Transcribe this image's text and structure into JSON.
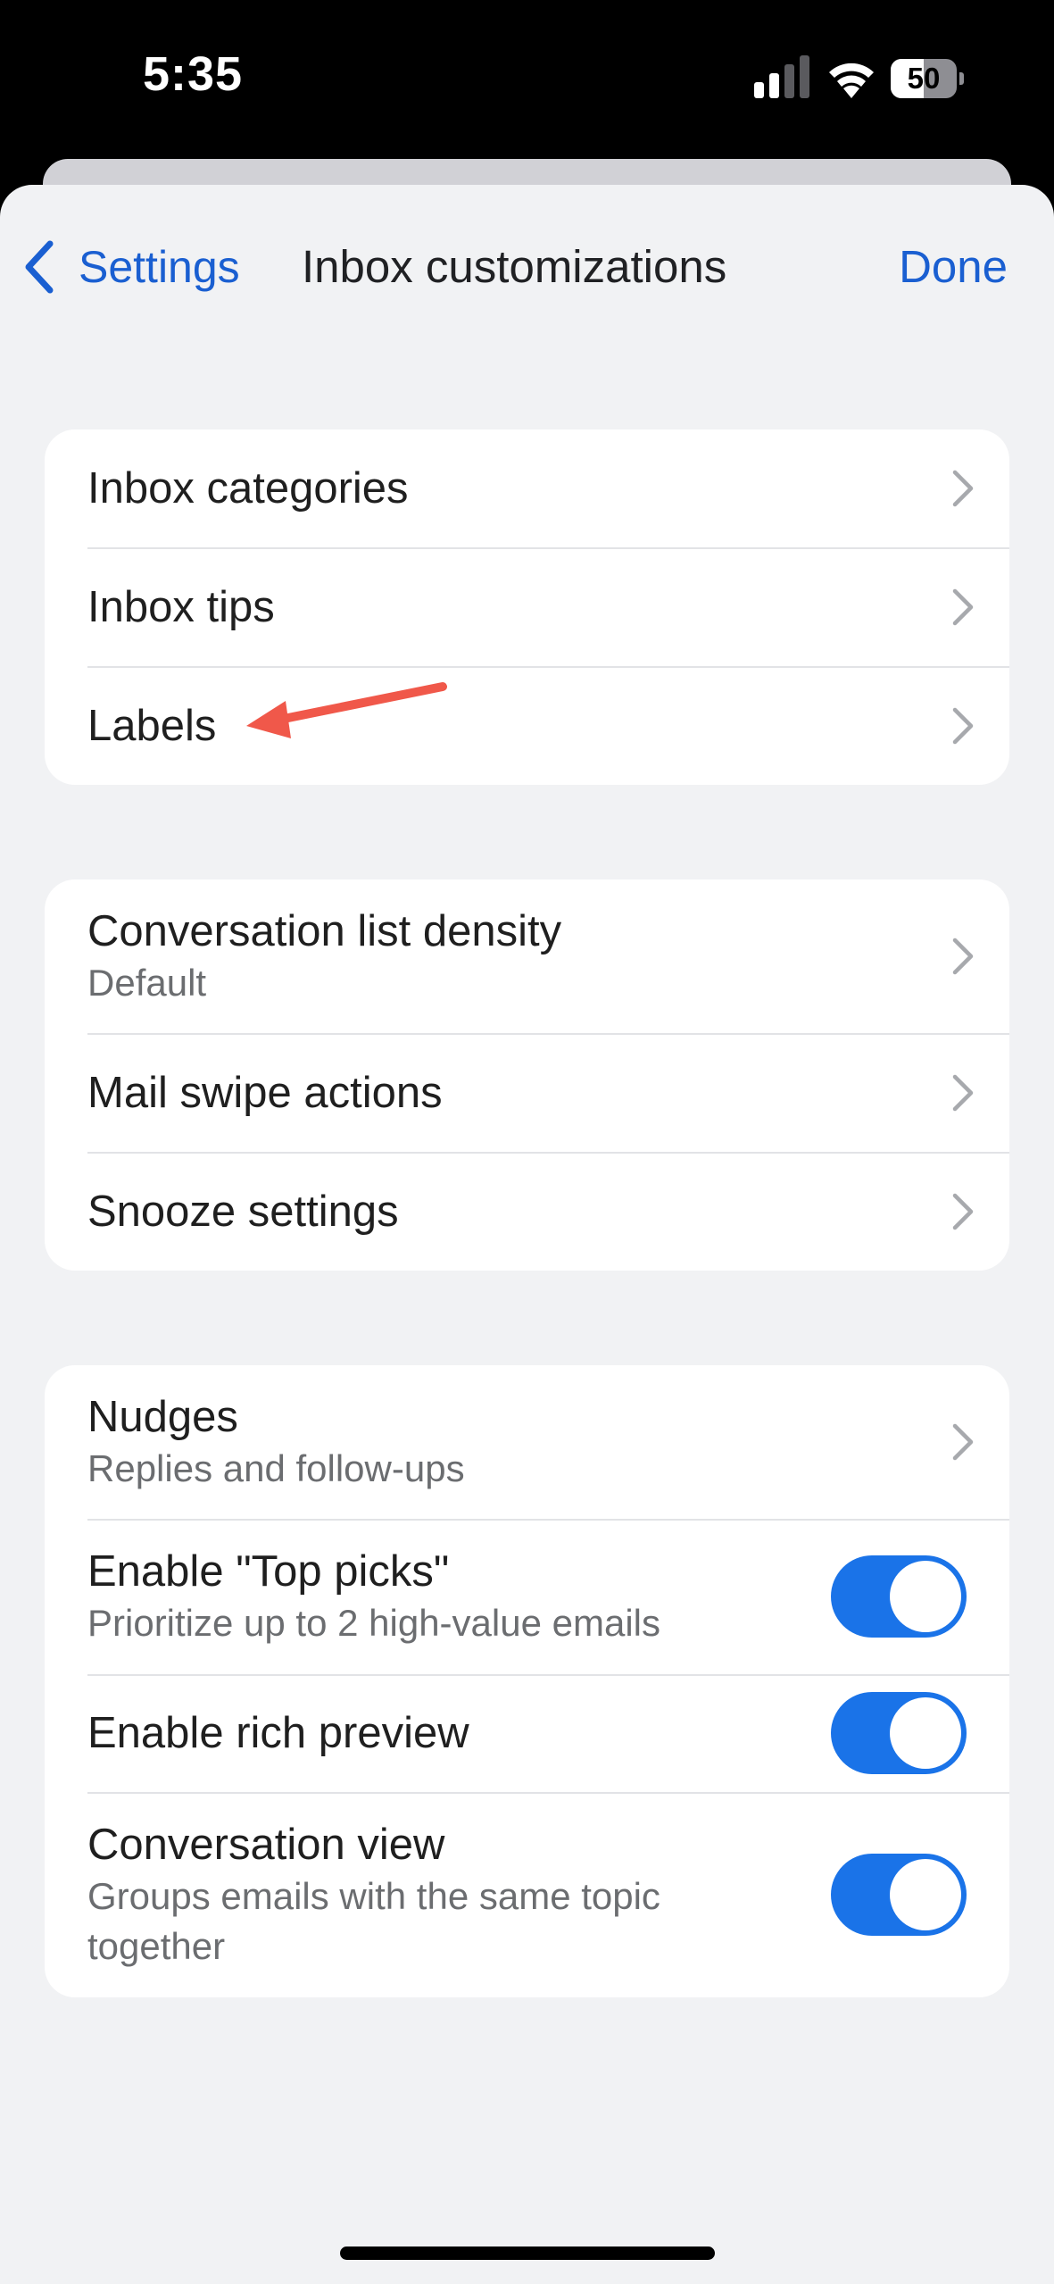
{
  "status_bar": {
    "time": "5:35",
    "battery": "50"
  },
  "nav": {
    "back_label": "Settings",
    "title": "Inbox customizations",
    "done_label": "Done"
  },
  "group1": [
    {
      "title": "Inbox categories"
    },
    {
      "title": "Inbox tips"
    },
    {
      "title": "Labels"
    }
  ],
  "group2": [
    {
      "title": "Conversation list density",
      "subtitle": "Default"
    },
    {
      "title": "Mail swipe actions"
    },
    {
      "title": "Snooze settings"
    }
  ],
  "group3": [
    {
      "title": "Nudges",
      "subtitle": "Replies and follow-ups"
    },
    {
      "title": "Enable \"Top picks\"",
      "subtitle": "Prioritize up to 2 high-value emails",
      "enabled": true
    },
    {
      "title": "Enable rich preview",
      "enabled": true
    },
    {
      "title": "Conversation view",
      "subtitle": "Groups emails with the same topic together",
      "enabled": true
    }
  ],
  "colors": {
    "accent": "#1a5fd1",
    "toggle_on": "#1a73e8",
    "annotation_arrow": "#f0584a",
    "background": "#f1f2f4"
  },
  "icons": [
    "cellular-signal-icon",
    "wifi-icon",
    "battery-icon",
    "chevron-left-icon",
    "chevron-right-icon",
    "annotation-arrow-icon"
  ]
}
